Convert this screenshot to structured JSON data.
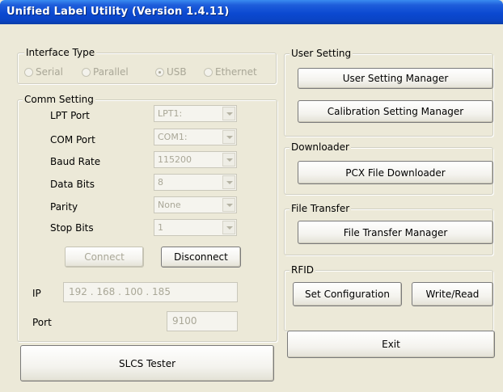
{
  "window": {
    "title": "Unified Label Utility  (Version 1.4.11)"
  },
  "interface": {
    "legend": "Interface Type",
    "options": [
      "Serial",
      "Parallel",
      "USB",
      "Ethernet"
    ],
    "selected": "USB"
  },
  "comm": {
    "legend": "Comm Setting",
    "lpt_label": "LPT Port",
    "lpt_value": "LPT1:",
    "com_label": "COM Port",
    "com_value": "COM1:",
    "baud_label": "Baud Rate",
    "baud_value": "115200",
    "databits_label": "Data Bits",
    "databits_value": "8",
    "parity_label": "Parity",
    "parity_value": "None",
    "stopbits_label": "Stop Bits",
    "stopbits_value": "1",
    "connect_label": "Connect",
    "disconnect_label": "Disconnect",
    "ip_label": "IP",
    "ip_value": "192  .  168  .  100  .  185",
    "port_label": "Port",
    "port_value": "9100"
  },
  "slcs": {
    "label": "SLCS Tester"
  },
  "user_setting": {
    "legend": "User Setting",
    "manager_label": "User Setting Manager",
    "calibration_label": "Calibration Setting Manager"
  },
  "downloader": {
    "legend": "Downloader",
    "pcx_label": "PCX File Downloader"
  },
  "file_transfer": {
    "legend": "File Transfer",
    "manager_label": "File Transfer Manager"
  },
  "rfid": {
    "legend": "RFID",
    "config_label": "Set Configuration",
    "write_read_label": "Write/Read"
  },
  "exit": {
    "label": "Exit"
  }
}
